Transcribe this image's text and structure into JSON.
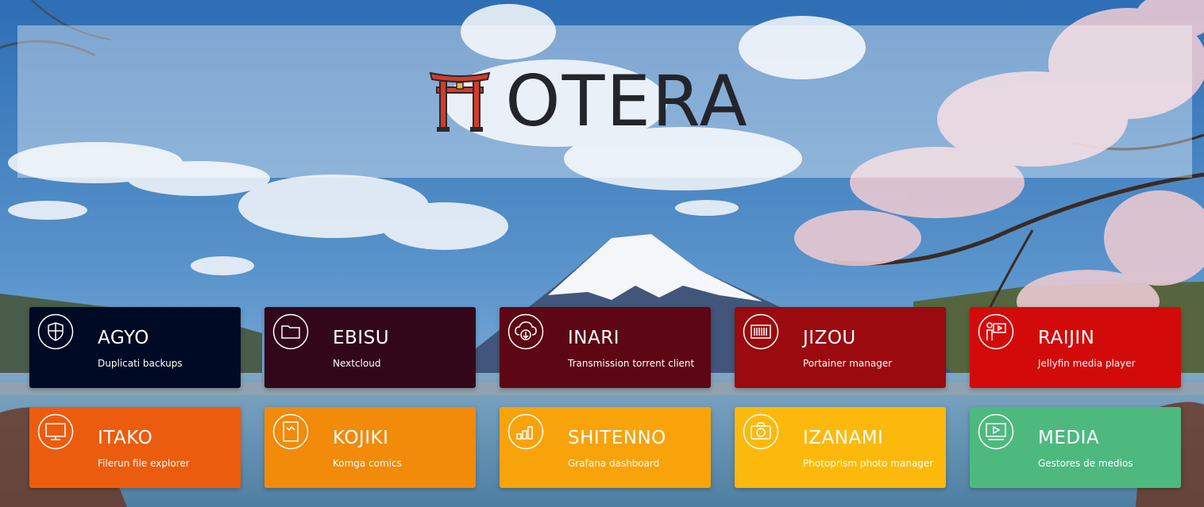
{
  "header": {
    "brand": "OTERA"
  },
  "colors": {
    "sky": "#3f7fc0",
    "brand_text": "#23252b",
    "torii": "#d43b2a"
  },
  "tiles": [
    {
      "title": "AGYO",
      "subtitle": "Duplicati backups",
      "icon": "shield-icon",
      "color": "#000a24"
    },
    {
      "title": "EBISU",
      "subtitle": "Nextcloud",
      "icon": "folder-icon",
      "color": "#33071a"
    },
    {
      "title": "INARI",
      "subtitle": "Transmission torrent client",
      "icon": "cloud-download-icon",
      "color": "#5c0713"
    },
    {
      "title": "JIZOU",
      "subtitle": "Portainer manager",
      "icon": "container-icon",
      "color": "#9a0a0e"
    },
    {
      "title": "RAIJIN",
      "subtitle": "Jellyfin media player",
      "icon": "presenter-icon",
      "color": "#d30a0a"
    },
    {
      "title": "ITAKO",
      "subtitle": "Filerun file explorer",
      "icon": "monitor-icon",
      "color": "#ec5c0e"
    },
    {
      "title": "KOJIKI",
      "subtitle": "Komga comics",
      "icon": "book-icon",
      "color": "#f28a0a"
    },
    {
      "title": "SHITENNO",
      "subtitle": "Grafana dashboard",
      "icon": "bar-chart-icon",
      "color": "#f8a30a"
    },
    {
      "title": "IZANAMI",
      "subtitle": "Photoprism photo manager",
      "icon": "camera-icon",
      "color": "#fdb90b"
    },
    {
      "title": "MEDIA",
      "subtitle": "Gestores de medios",
      "icon": "video-player-icon",
      "color": "#4db97f"
    }
  ]
}
